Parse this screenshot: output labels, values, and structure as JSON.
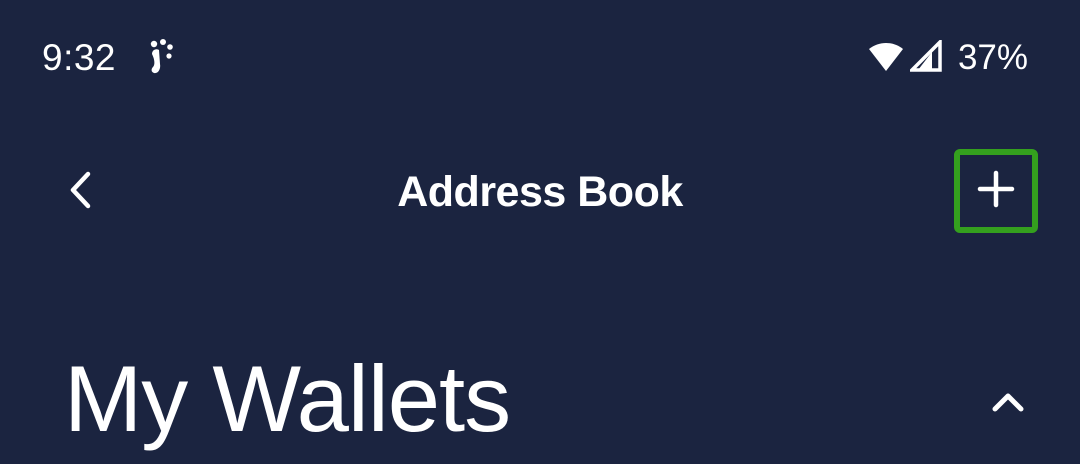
{
  "status_bar": {
    "time": "9:32",
    "app_icon": "notification-app-icon",
    "battery": "37%",
    "icons": [
      "wifi-icon",
      "cell-signal-icon"
    ]
  },
  "app_bar": {
    "title": "Address Book",
    "back_icon": "chevron-left-icon",
    "add_icon": "plus-icon",
    "highlight_color": "#34a01e"
  },
  "section": {
    "title": "My Wallets",
    "toggle_icon": "chevron-up-icon"
  },
  "theme": {
    "background": "#1b2440",
    "foreground": "#ffffff"
  }
}
